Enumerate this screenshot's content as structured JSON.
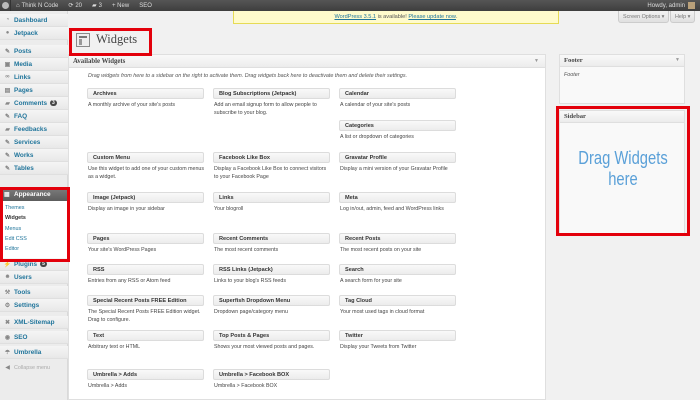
{
  "adminbar": {
    "site_name": "Think N Code",
    "updates_count": "20",
    "comments_count": "3",
    "new_label": "+ New",
    "seo_label": "SEO",
    "howdy": "Howdy, admin"
  },
  "notice": {
    "version_text": "WordPress 3.5.1",
    "middle_text": " is available! ",
    "link_text": "Please update now",
    "tail": "."
  },
  "screen_options": "Screen Options ▾",
  "help": "Help ▾",
  "page_title": "Widgets",
  "menu": {
    "dashboard": "Dashboard",
    "jetpack": "Jetpack",
    "posts": "Posts",
    "media": "Media",
    "links": "Links",
    "pages": "Pages",
    "comments": "Comments",
    "comments_count": "3",
    "faq": "FAQ",
    "feedbacks": "Feedbacks",
    "services": "Services",
    "works": "Works",
    "tables": "Tables",
    "appearance": "Appearance",
    "sub": [
      "Themes",
      "Widgets",
      "Menus",
      "Edit CSS",
      "Editor"
    ],
    "plugins": "Plugins",
    "plugins_count": "5",
    "users": "Users",
    "tools": "Tools",
    "settings": "Settings",
    "xml_sitemap": "XML-Sitemap",
    "seo": "SEO",
    "umbrella": "Umbrella",
    "collapse": "Collapse menu"
  },
  "available": {
    "title": "Available Widgets",
    "description": "Drag widgets from here to a sidebar on the right to activate them. Drag widgets back here to deactivate them and delete their settings.",
    "widgets": [
      {
        "title": "Archives",
        "desc": "A monthly archive of your site's posts"
      },
      {
        "title": "Blog Subscriptions (Jetpack)",
        "desc": "Add an email signup form to allow people to subscribe to your blog."
      },
      {
        "title": "Calendar",
        "desc": "A calendar of your site's posts"
      },
      {
        "title": "Categories",
        "desc": "A list or dropdown of categories"
      },
      {
        "title": "Custom Menu",
        "desc": "Use this widget to add one of your custom menus as a widget."
      },
      {
        "title": "Facebook Like Box",
        "desc": "Display a Facebook Like Box to connect visitors to your Facebook Page"
      },
      {
        "title": "Gravatar Profile",
        "desc": "Display a mini version of your Gravatar Profile"
      },
      {
        "title": "Image (Jetpack)",
        "desc": "Display an image in your sidebar"
      },
      {
        "title": "Links",
        "desc": "Your blogroll"
      },
      {
        "title": "Meta",
        "desc": "Log in/out, admin, feed and WordPress links"
      },
      {
        "title": "Pages",
        "desc": "Your site's WordPress Pages"
      },
      {
        "title": "Recent Comments",
        "desc": "The most recent comments"
      },
      {
        "title": "Recent Posts",
        "desc": "The most recent posts on your site"
      },
      {
        "title": "RSS",
        "desc": "Entries from any RSS or Atom feed"
      },
      {
        "title": "RSS Links (Jetpack)",
        "desc": "Links to your blog's RSS feeds"
      },
      {
        "title": "Search",
        "desc": "A search form for your site"
      },
      {
        "title": "Special Recent Posts FREE Edition",
        "desc": "The Special Recent Posts FREE Edition widget. Drag to configure."
      },
      {
        "title": "Superfish Dropdown Menu",
        "desc": "Dropdown page/category menu"
      },
      {
        "title": "Tag Cloud",
        "desc": "Your most used tags in cloud format"
      },
      {
        "title": "Text",
        "desc": "Arbitrary text or HTML"
      },
      {
        "title": "Top Posts & Pages",
        "desc": "Shows your most viewed posts and pages."
      },
      {
        "title": "Twitter",
        "desc": "Display your Tweets from Twitter"
      },
      {
        "title": "Umbrella > Adds",
        "desc": "Umbrella > Adds"
      },
      {
        "title": "Umbrella > Facebook BOX",
        "desc": "Umbrella > Facebook BOX"
      }
    ]
  },
  "footer_sidebar": {
    "title": "Footer",
    "desc": "Footer"
  },
  "sidebar_sidebar": {
    "title": "Sidebar",
    "drag_line1": "Drag Widgets",
    "drag_line2": "here"
  },
  "colors": {
    "link": "#21759b",
    "highlight": "#e3000b",
    "annotation": "#5aa0d8"
  }
}
